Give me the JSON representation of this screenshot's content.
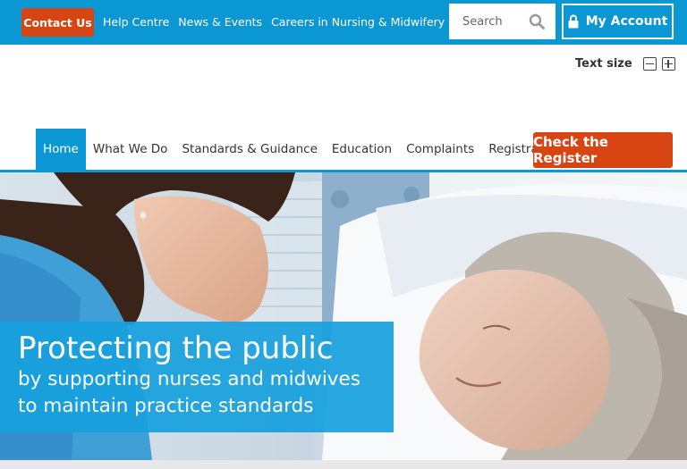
{
  "topbar": {
    "contact_label": "Contact Us",
    "links": [
      "Help Centre",
      "News & Events",
      "Careers in Nursing & Midwifery"
    ],
    "search_placeholder": "Search",
    "account_label": "My Account",
    "color": "#0b96d4"
  },
  "textsize": {
    "label": "Text size"
  },
  "nav": {
    "items": [
      "Home",
      "What We Do",
      "Standards & Guidance",
      "Education",
      "Complaints",
      "Registration"
    ],
    "active": "Home",
    "cta_label": "Check the Register",
    "cta_color": "#d74513"
  },
  "hero": {
    "title": "Protecting the public",
    "subtitle_line1": "by supporting nurses and midwives",
    "subtitle_line2": "to maintain practice standards"
  }
}
